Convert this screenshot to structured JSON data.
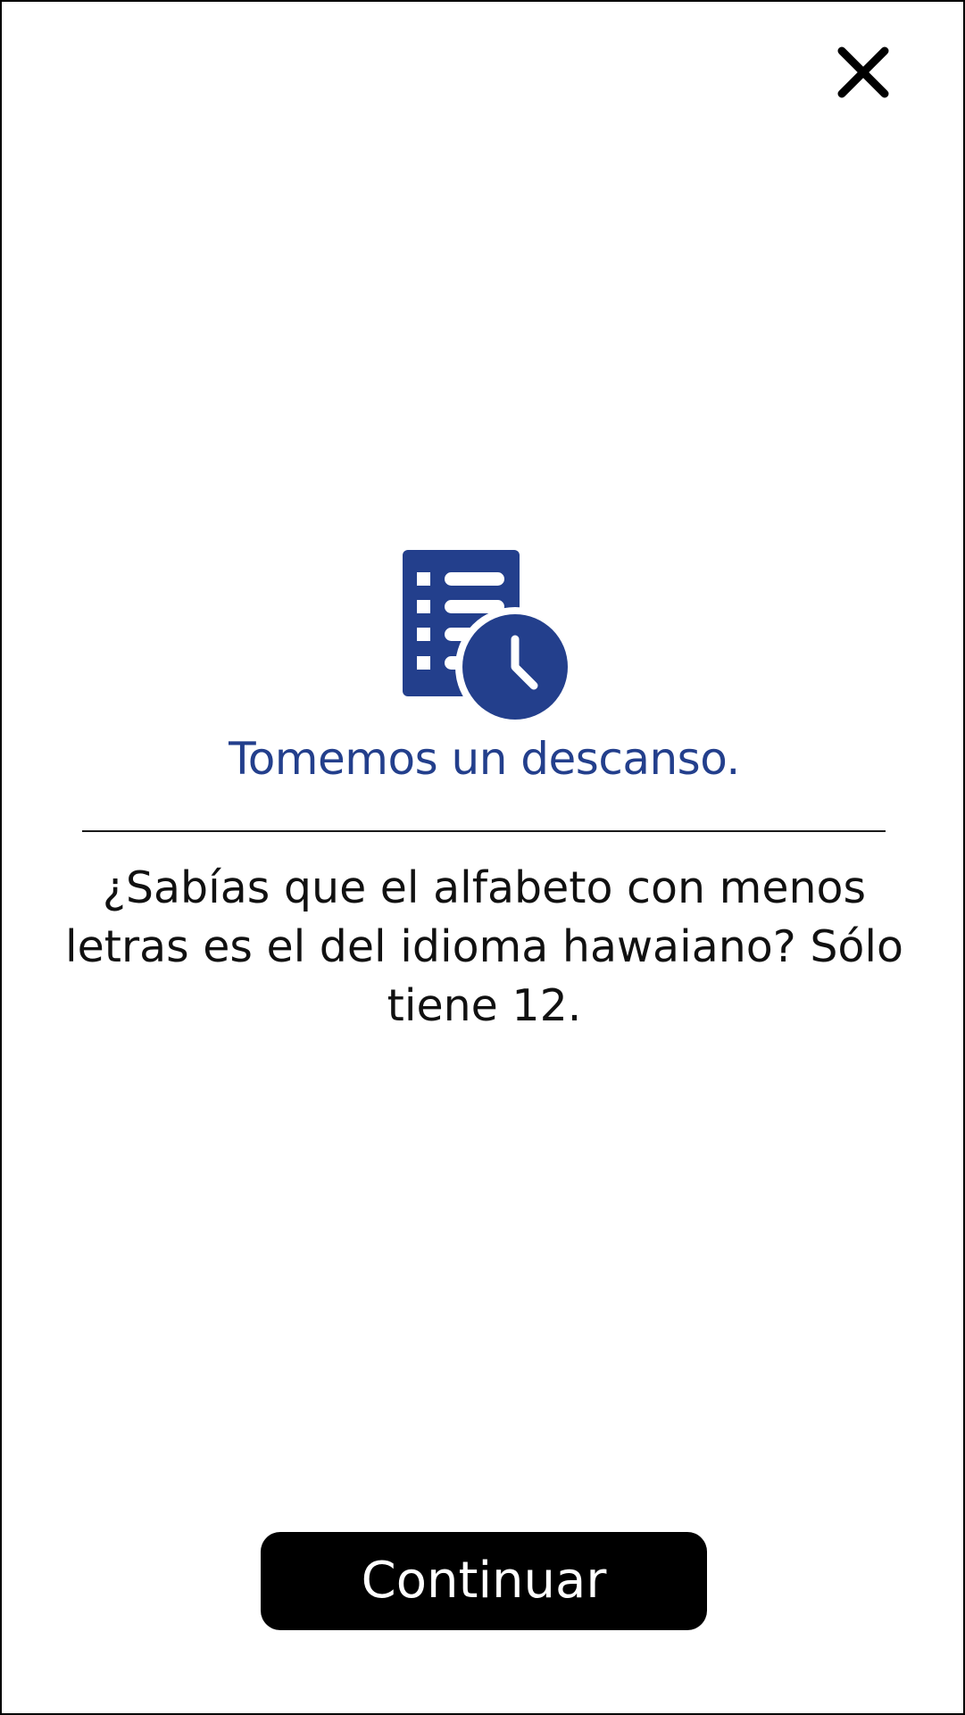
{
  "close": {
    "icon": "close-icon"
  },
  "hero": {
    "icon": "schedule-list-clock-icon",
    "title": "Tomemos un descanso."
  },
  "fact": {
    "text": "¿Sabías que el alfabeto con menos letras es el del idioma hawaiano? Sólo tiene 12."
  },
  "actions": {
    "continue_label": "Continuar"
  },
  "colors": {
    "accent": "#233f8c",
    "text": "#111111",
    "button_bg": "#000000",
    "button_text": "#ffffff",
    "background": "#ffffff"
  }
}
